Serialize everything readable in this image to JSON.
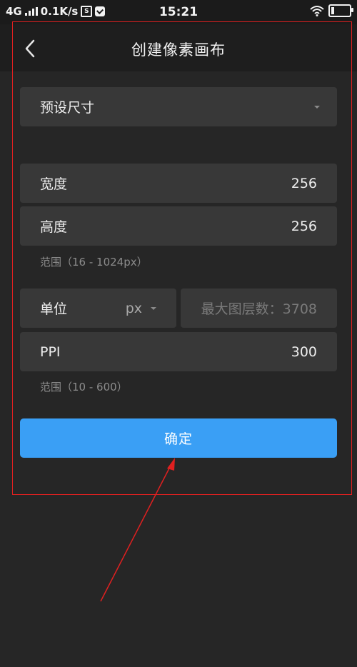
{
  "status_bar": {
    "network": "4G",
    "speed": "0.1K/s",
    "sim_icon_label": "S",
    "time": "15:21",
    "icons": [
      "signal-icon",
      "sim-icon",
      "message-icon",
      "wifi-icon",
      "battery-icon"
    ]
  },
  "header": {
    "title": "创建像素画布",
    "back_icon": "chevron-left-icon"
  },
  "form": {
    "preset_label": "预设尺寸",
    "width_label": "宽度",
    "width_value": "256",
    "height_label": "高度",
    "height_value": "256",
    "size_range_hint": "范围（16 - 1024px）",
    "unit_label": "单位",
    "unit_value": "px",
    "max_layers_text": "最大图层数：3708",
    "ppi_label": "PPI",
    "ppi_value": "300",
    "ppi_range_hint": "范围（10 - 600）"
  },
  "confirm_label": "确定",
  "colors": {
    "background": "#262626",
    "card": "#383838",
    "accent": "#3a9ff5",
    "annotation": "#e02020"
  }
}
